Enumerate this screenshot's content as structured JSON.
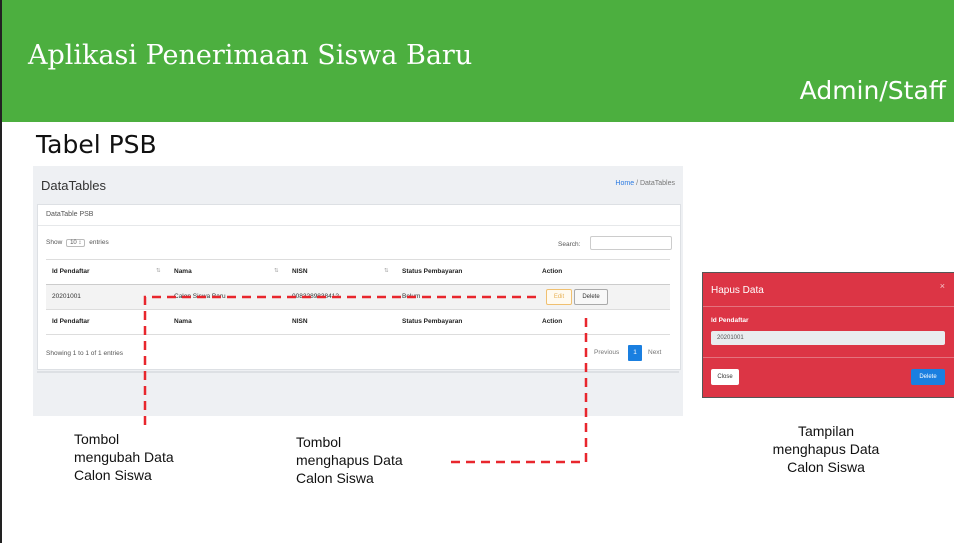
{
  "header": {
    "title": "Aplikasi Penerimaan Siswa Baru",
    "role": "Admin/Staff"
  },
  "section_title": "Tabel PSB",
  "datatable": {
    "title": "DataTables",
    "breadcrumb": {
      "home": "Home",
      "sep": "/",
      "current": "DataTables"
    },
    "panel_title": "DataTable PSB",
    "show_label": "Show",
    "show_value": "10 ↕",
    "entries_label": "entries",
    "search_label": "Search:",
    "columns": [
      "Id Pendaftar",
      "Nama",
      "NISN",
      "Status Pembayaran",
      "Action"
    ],
    "sort_icons": [
      "⇅",
      "⇅",
      "⇅"
    ],
    "row": {
      "id": "20201001",
      "nama": "Calon Siswa Baru",
      "nisn": "0083289838412",
      "status": "Belum"
    },
    "edit_label": "Edit",
    "delete_label": "Delete",
    "info": "Showing 1 to 1 of 1 entries",
    "pagination": {
      "prev": "Previous",
      "page": "1",
      "next": "Next"
    }
  },
  "modal": {
    "title": "Hapus Data",
    "close_x": "×",
    "field_label": "Id Pendaftar",
    "field_value": "20201001",
    "close_button": "Close",
    "delete_button": "Delete"
  },
  "captions": {
    "edit_lines": [
      "Tombol",
      "mengubah Data",
      "Calon Siswa"
    ],
    "delete_lines": [
      "Tombol",
      "menghapus Data",
      "Calon Siswa"
    ],
    "modal_lines": [
      "Tampilan",
      "menghapus Data",
      "Calon Siswa"
    ]
  },
  "colors": {
    "banner": "#4caf3f",
    "modal": "#dc3545",
    "primary": "#1a7fe0",
    "arrow": "#e8262d"
  }
}
